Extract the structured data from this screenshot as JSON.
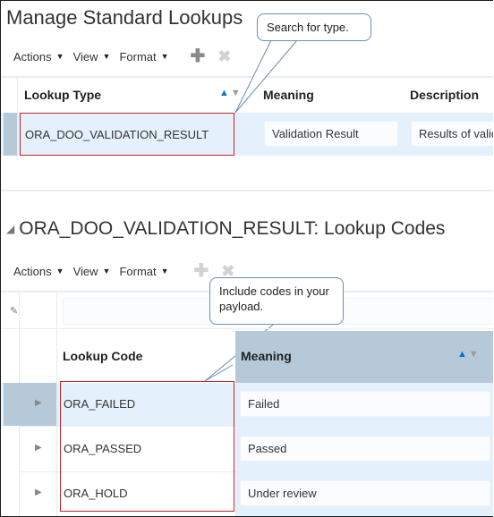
{
  "page": {
    "title": "Manage Standard Lookups"
  },
  "upper_toolbar": {
    "menus": [
      {
        "label": "Actions",
        "icon": "caret-down-icon"
      },
      {
        "label": "View",
        "icon": "caret-down-icon"
      },
      {
        "label": "Format",
        "icon": "caret-down-icon"
      }
    ],
    "add_icon": "plus-icon",
    "delete_icon": "x-icon"
  },
  "upper_table": {
    "columns": [
      "Lookup Type",
      "Meaning",
      "Description"
    ],
    "sort_column": "Lookup Type",
    "rows": [
      {
        "lookup_type": "ORA_DOO_VALIDATION_RESULT",
        "meaning": "Validation Result",
        "description": "Results of valid"
      }
    ]
  },
  "callouts": {
    "search": "Search for type.",
    "codes": "Include codes in your payload."
  },
  "section": {
    "title": "ORA_DOO_VALIDATION_RESULT: Lookup Codes",
    "collapse_icon": "triangle-expanded-icon"
  },
  "lower_toolbar": {
    "menus": [
      {
        "label": "Actions",
        "icon": "caret-down-icon"
      },
      {
        "label": "View",
        "icon": "caret-down-icon"
      },
      {
        "label": "Format",
        "icon": "caret-down-icon"
      }
    ],
    "add_icon": "plus-icon",
    "delete_icon": "x-icon",
    "filter_icon": "clear-filter-icon"
  },
  "lower_table": {
    "columns": [
      "Lookup Code",
      "Meaning"
    ],
    "sort_column": "Meaning",
    "rows": [
      {
        "lookup_code": "ORA_FAILED",
        "meaning": "Failed",
        "selected": true
      },
      {
        "lookup_code": "ORA_PASSED",
        "meaning": "Passed",
        "selected": false
      },
      {
        "lookup_code": "ORA_HOLD",
        "meaning": "Under review",
        "selected": false
      }
    ]
  },
  "colors": {
    "highlight_border": "#c0262d",
    "selected_row": "#e4f0fc",
    "selector": "#b6c9d8",
    "sort_active": "#0572ce",
    "callout_border": "#6d8fb0"
  },
  "glyphs": {
    "caret": "▼",
    "plus": "✚",
    "x": "✖",
    "sort_asc": "▲",
    "sort_desc": "▼",
    "expander": "▶",
    "collapse": "◢",
    "eraser": "✎"
  }
}
